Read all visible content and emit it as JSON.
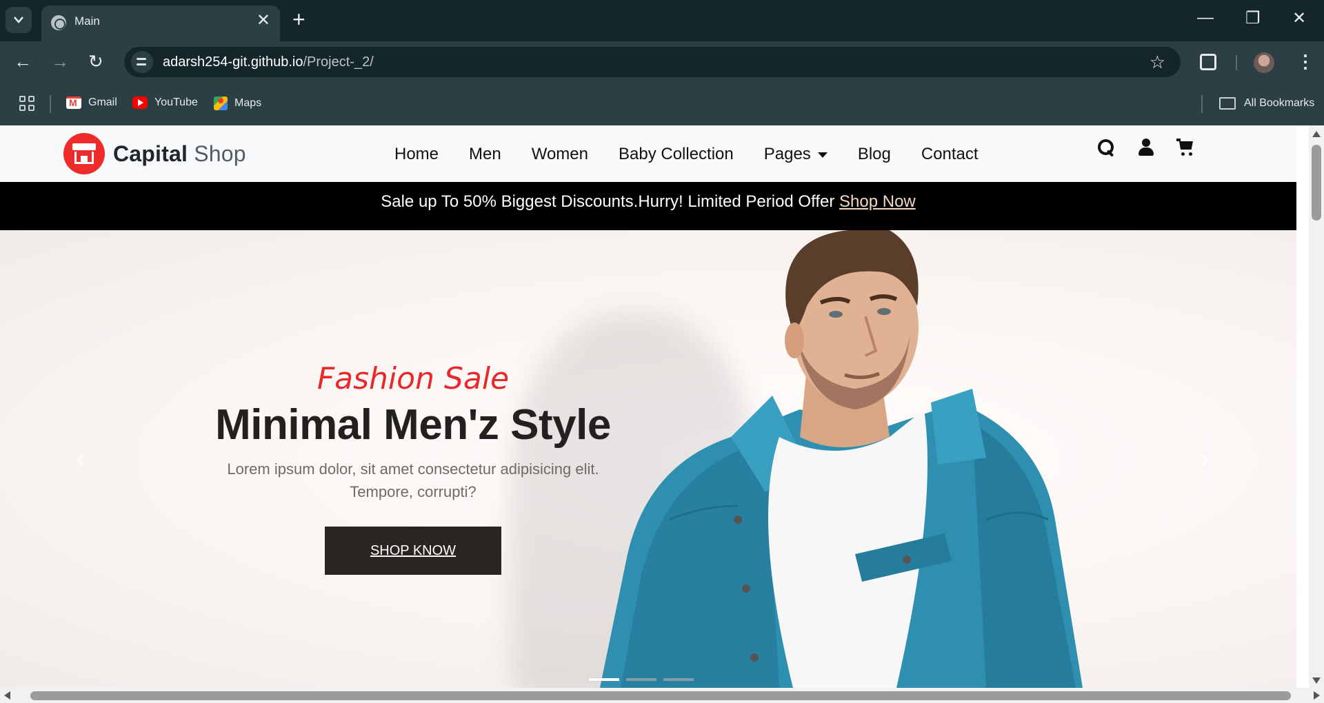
{
  "browser": {
    "tab_title": "Main",
    "url_host": "adarsh254-git.github.io",
    "url_path": "/Project-_2/",
    "bookmarks": [
      {
        "label": "Gmail",
        "icon": "gmail-icon"
      },
      {
        "label": "YouTube",
        "icon": "youtube-icon"
      },
      {
        "label": "Maps",
        "icon": "maps-icon"
      }
    ],
    "all_bookmarks_label": "All Bookmarks"
  },
  "site": {
    "logo": {
      "bold": "Capital",
      "light": "Shop"
    },
    "nav": [
      {
        "label": "Home"
      },
      {
        "label": "Men"
      },
      {
        "label": "Women"
      },
      {
        "label": "Baby Collection"
      },
      {
        "label": "Pages",
        "has_dropdown": true
      },
      {
        "label": "Blog"
      },
      {
        "label": "Contact"
      }
    ],
    "nav_icons": [
      "search-icon",
      "user-icon",
      "cart-icon"
    ]
  },
  "promo": {
    "text": "Sale up To 50% Biggest Discounts.Hurry! Limited Period Offer ",
    "link": "Shop Now"
  },
  "hero": {
    "kicker": "Fashion Sale",
    "title": "Minimal Men'z Style",
    "description": "Lorem ipsum dolor, sit amet consectetur adipisicing elit. Tempore, corrupti?",
    "button": "SHOP KNOW",
    "slide_count": 3,
    "active_slide": 1
  },
  "colors": {
    "accent_red": "#e8282b",
    "button_dark": "#2a2522",
    "promo_link": "#f3d9c1",
    "denim": "#2f8fb0"
  }
}
